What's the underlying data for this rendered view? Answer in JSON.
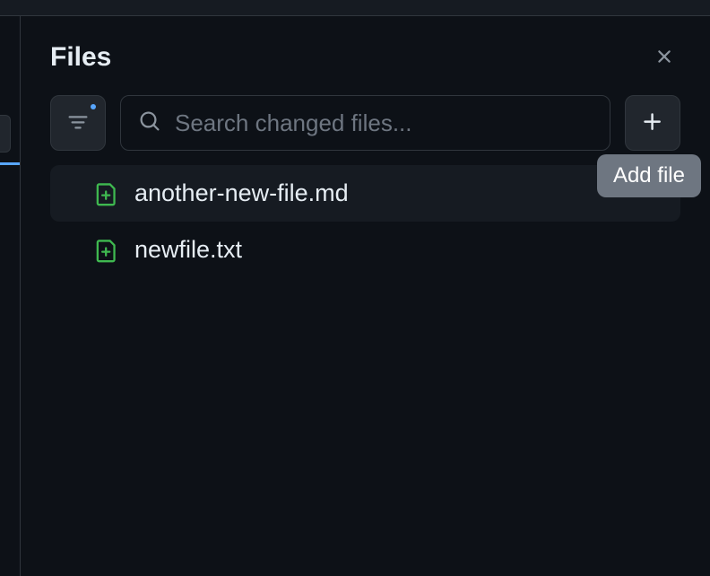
{
  "panel": {
    "title": "Files"
  },
  "search": {
    "placeholder": "Search changed files..."
  },
  "tooltip": {
    "add_file": "Add file"
  },
  "files": [
    {
      "name": "another-new-file.md",
      "active": true
    },
    {
      "name": "newfile.txt",
      "active": false
    }
  ]
}
